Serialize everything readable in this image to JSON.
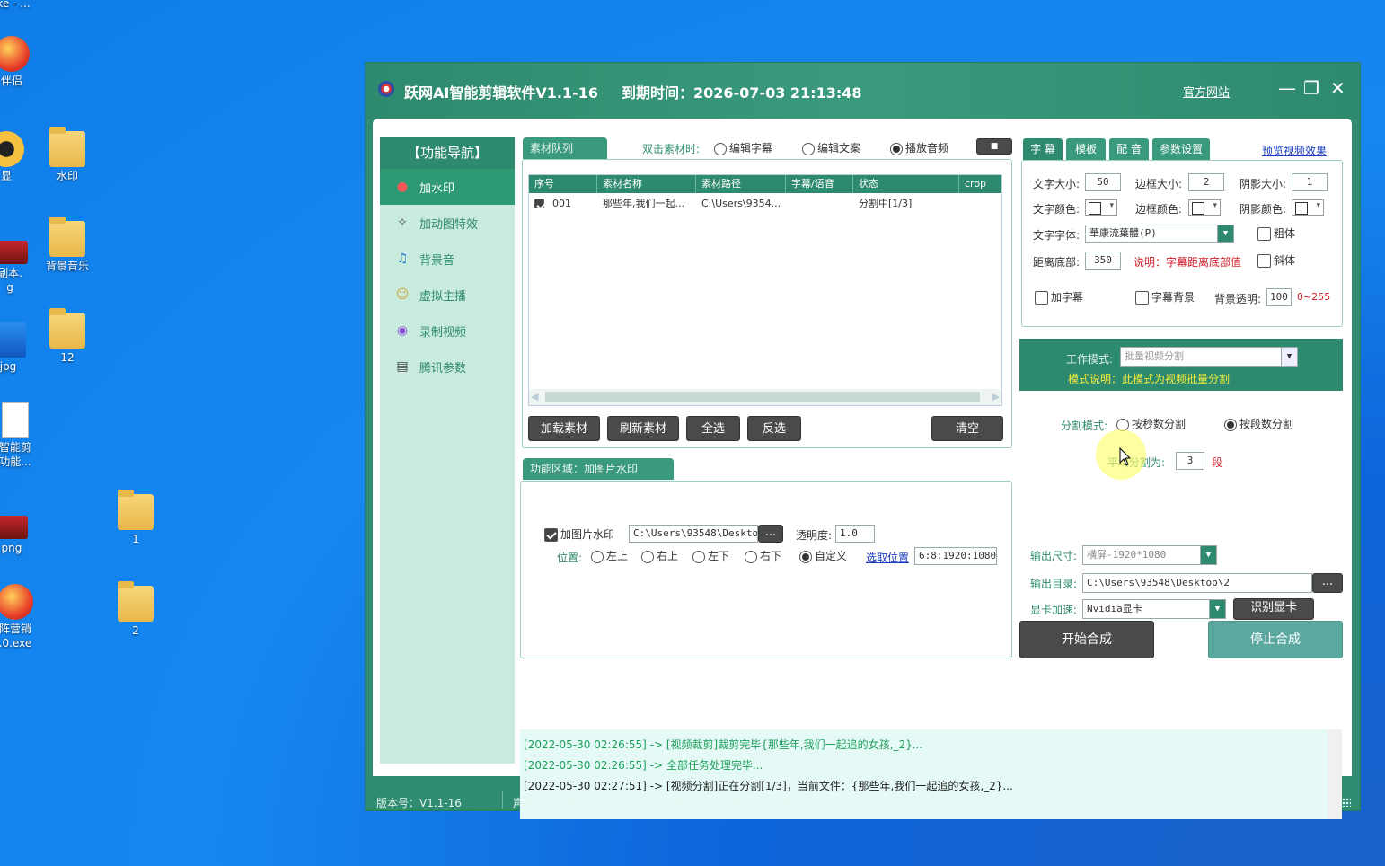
{
  "desktop": {
    "icons": [
      {
        "label": "ke - ..."
      },
      {
        "label": "伴侣"
      },
      {
        "label": "显"
      },
      {
        "label": "水印"
      },
      {
        "label": "副本.\ng"
      },
      {
        "label": "背景音乐"
      },
      {
        "label": "jpg"
      },
      {
        "label": "12"
      },
      {
        "label": "智能剪\n功能..."
      },
      {
        "label": ".png"
      },
      {
        "label": "1"
      },
      {
        "label": "阵营销\n.0.exe"
      },
      {
        "label": "2"
      }
    ]
  },
  "window": {
    "title": "跃网AI智能剪辑软件V1.1-16",
    "expire": "到期时间：2026-07-03 21:13:48",
    "official_site": "官方网站",
    "min": "—",
    "max": "❐",
    "close": "✕"
  },
  "nav": {
    "header": "【功能导航】",
    "items": [
      {
        "label": "加水印",
        "icon": "●"
      },
      {
        "label": "加动图特效",
        "icon": "✧"
      },
      {
        "label": "背景音",
        "icon": "♫"
      },
      {
        "label": "虚拟主播",
        "icon": "☺"
      },
      {
        "label": "录制视频",
        "icon": "◉"
      },
      {
        "label": "腾讯参数",
        "icon": "▤"
      }
    ]
  },
  "queue": {
    "tab": "素材队列",
    "dblclick_label": "双击素材时:",
    "options": [
      "编辑字幕",
      "编辑文案",
      "播放音频"
    ],
    "stop_btn": "■",
    "columns": [
      "序号",
      "素材名称",
      "素材路径",
      "字幕/语音",
      "状态",
      "crop"
    ],
    "rows": [
      {
        "no": "001",
        "name": "那些年,我们一起...",
        "path": "C:\\Users\\9354...",
        "sub": "",
        "status": "分割中[1/3]"
      }
    ],
    "scroll_left": "◀",
    "scroll_right": "▶",
    "buttons": {
      "load": "加载素材",
      "refresh": "刷新素材",
      "all": "全选",
      "invert": "反选",
      "clear": "清空"
    }
  },
  "func": {
    "tab": "功能区域：加图片水印",
    "add_image_watermark": "加图片水印",
    "path": "C:\\Users\\93548\\Desktop\\",
    "browse": "...",
    "opacity_label": "透明度:",
    "opacity": "1.0",
    "position_label": "位置:",
    "positions": [
      "左上",
      "右上",
      "左下",
      "右下",
      "自定义"
    ],
    "pick_position": "选取位置",
    "position_value": "6:8:1920:1080"
  },
  "right_tabs": [
    "字 幕",
    "模板",
    "配 音",
    "参数设置"
  ],
  "preview_link": "预览视频效果",
  "subtitle": {
    "font_size_label": "文字大小:",
    "font_size": "50",
    "border_size_label": "边框大小:",
    "border_size": "2",
    "shadow_size_label": "阴影大小:",
    "shadow_size": "1",
    "font_color_label": "文字颜色:",
    "border_color_label": "边框颜色:",
    "shadow_color_label": "阴影颜色:",
    "font_label": "文字字体:",
    "font": "華康流葉體(P)",
    "bold": "粗体",
    "bottom_label": "距离底部:",
    "bottom": "350",
    "explain": "说明：字幕距离底部值",
    "italic": "斜体",
    "add_sub": "加字幕",
    "sub_bg": "字幕背景",
    "bg_opacity_label": "背景透明:",
    "bg_opacity": "100",
    "bg_range": "0~255"
  },
  "mode": {
    "label": "工作模式:",
    "value": "批量视频分割",
    "desc": "模式说明：此模式为视频批量分割",
    "split_label": "分割模式:",
    "split_options": [
      "按秒数分割",
      "按段数分割"
    ],
    "avg_label": "平均分割为:",
    "avg_value": "3",
    "avg_unit": "段"
  },
  "output": {
    "size_label": "输出尺寸:",
    "size": "横屏-1920*1080",
    "dir_label": "输出目录:",
    "dir": "C:\\Users\\93548\\Desktop\\2",
    "dir_browse": "...",
    "gpu_label": "显卡加速:",
    "gpu": "Nvidia显卡",
    "detect_gpu": "识别显卡",
    "start": "开始合成",
    "stop": "停止合成"
  },
  "log": [
    {
      "text": "[2022-05-30 02:26:55] -> [视频裁剪]裁剪完毕{那些年,我们一起追的女孩,_2}...",
      "color": "green"
    },
    {
      "text": "[2022-05-30 02:26:55] -> 全部任务处理完毕...",
      "color": "green"
    },
    {
      "text": "[2022-05-30 02:27:51] -> [视频分割]正在分割[1/3]，当前文件：{那些年,我们一起追的女孩,_2}...",
      "color": "black"
    }
  ],
  "status": {
    "version": "版本号：V1.1-16",
    "notice": "声明：本软件仅用于个人原创音视频素材的处理，使用本软件请遵守相关规定!"
  },
  "colors": {
    "accent": "#2e8a6e",
    "log_green": "#1e9f5a",
    "warn_red": "#d0202a"
  }
}
